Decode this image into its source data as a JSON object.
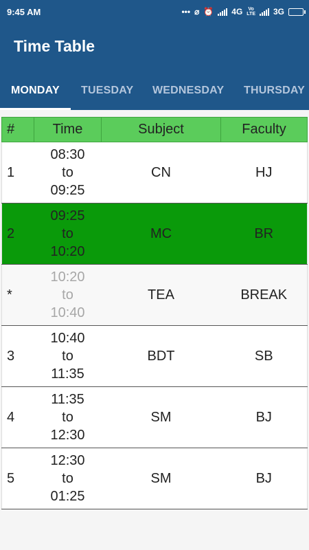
{
  "status": {
    "time": "9:45 AM",
    "network1": "4G",
    "network2": "3G"
  },
  "app": {
    "title": "Time Table"
  },
  "tabs": [
    "MONDAY",
    "TUESDAY",
    "WEDNESDAY",
    "THURSDAY"
  ],
  "table": {
    "headers": [
      "#",
      "Time",
      "Subject",
      "Faculty"
    ],
    "rows": [
      {
        "num": "1",
        "from": "08:30",
        "sep": "to",
        "to": "09:25",
        "subject": "CN",
        "faculty": "HJ"
      },
      {
        "num": "2",
        "from": "09:25",
        "sep": "to",
        "to": "10:20",
        "subject": "MC",
        "faculty": "BR"
      },
      {
        "num": "*",
        "from": "10:20",
        "sep": "to",
        "to": "10:40",
        "subject": "TEA",
        "faculty": "BREAK"
      },
      {
        "num": "3",
        "from": "10:40",
        "sep": "to",
        "to": "11:35",
        "subject": "BDT",
        "faculty": "SB"
      },
      {
        "num": "4",
        "from": "11:35",
        "sep": "to",
        "to": "12:30",
        "subject": "SM",
        "faculty": "BJ"
      },
      {
        "num": "5",
        "from": "12:30",
        "sep": "to",
        "to": "01:25",
        "subject": "SM",
        "faculty": "BJ"
      }
    ]
  },
  "colors": {
    "appbar": "#1f578a",
    "header_row": "#5bcc5b",
    "current_row": "#0a9a0a"
  }
}
